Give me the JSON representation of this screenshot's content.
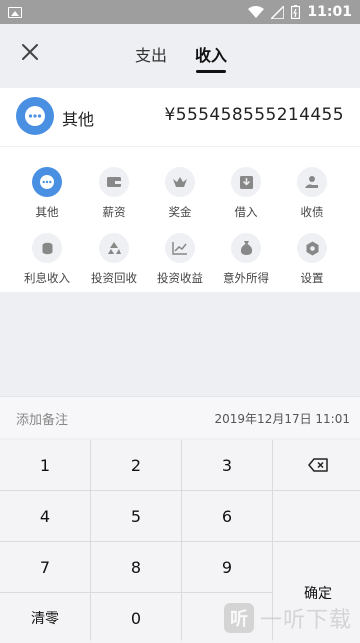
{
  "status_bar": {
    "time": "11:01"
  },
  "header": {
    "tabs": [
      {
        "label": "支出",
        "active": false
      },
      {
        "label": "收入",
        "active": true
      }
    ]
  },
  "selected_category": {
    "name": "其他",
    "amount": "¥555458555214455",
    "accent": "#4a90e2"
  },
  "categories": [
    {
      "label": "其他",
      "icon": "more-icon"
    },
    {
      "label": "薪资",
      "icon": "wallet-icon"
    },
    {
      "label": "奖金",
      "icon": "bonus-icon"
    },
    {
      "label": "借入",
      "icon": "inbox-icon"
    },
    {
      "label": "收债",
      "icon": "hand-coin-icon"
    },
    {
      "label": "利息收入",
      "icon": "coins-icon"
    },
    {
      "label": "投资回收",
      "icon": "recycle-icon"
    },
    {
      "label": "投资收益",
      "icon": "chart-icon"
    },
    {
      "label": "意外所得",
      "icon": "money-bag-icon"
    },
    {
      "label": "设置",
      "icon": "gear-icon"
    }
  ],
  "note": {
    "placeholder": "添加备注",
    "datetime": "2019年12月17日 11:01"
  },
  "keypad": {
    "k1": "1",
    "k2": "2",
    "k3": "3",
    "k4": "4",
    "k5": "5",
    "k6": "6",
    "k7": "7",
    "k8": "8",
    "k9": "9",
    "clear": "清零",
    "k0": "0",
    "confirm": "确定"
  },
  "watermark": {
    "text": "一听下载",
    "badge": "听"
  }
}
